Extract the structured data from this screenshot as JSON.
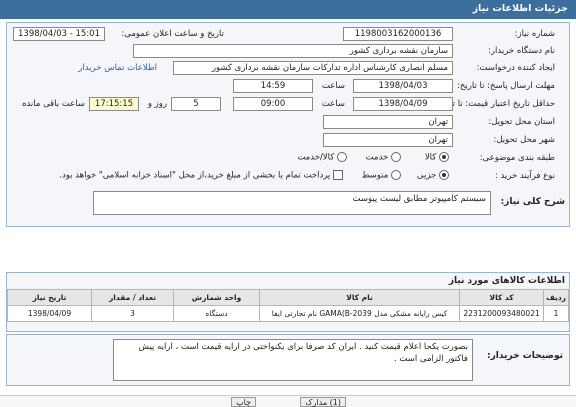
{
  "header": {
    "title": "جزئیات اطلاعات نیاز"
  },
  "form": {
    "need_number_label": "شماره نیاز:",
    "need_number": "1198003162000136",
    "announce_label": "تاریخ و ساعت اعلان عمومی:",
    "announce_value": "1398/04/03 - 15:01",
    "buyer_org_label": "نام دستگاه خریدار:",
    "buyer_org": "سازمان نقشه برداری کشور",
    "creator_label": "ایجاد کننده درخواست:",
    "creator": "مسلم انصاری کارشناس اداره تدارکات سازمان نقشه برداری کشور",
    "contact_link": "اطلاعات تماس خریدار",
    "deadline_label": "مهلت ارسال پاسخ: تا تاریخ:",
    "deadline_date": "1398/04/03",
    "time_label_1": "ساعت",
    "deadline_time": "14:59",
    "validity_label": "حداقل تاریخ اعتبار قیمت: تا تاریخ:",
    "validity_date": "1398/04/09",
    "time_label_2": "ساعت",
    "validity_time": "09:00",
    "days_value": "5",
    "days_label": "روز و",
    "remaining_time": "17:15:15",
    "remaining_label": "ساعت باقی مانده",
    "province_label": "استان محل تحویل:",
    "province": "تهران",
    "city_label": "شهر محل تحویل:",
    "city": "تهران",
    "category_label": "طبقه بندی موضوعی:",
    "category_options": [
      "کالا",
      "خدمت",
      "کالا/خدمت"
    ],
    "process_label": "نوع فرآیند خرید :",
    "process_options": [
      "جزیی",
      "متوسط"
    ],
    "payment_note": "پرداخت تمام یا بخشی از مبلغ خرید،از محل \"اسناد خزانه اسلامی\" خواهد بود."
  },
  "need_summary": {
    "label": "شرح کلی نیاز:",
    "value": "سیستم کامپیوتر مطابق لیست پیوست"
  },
  "goods": {
    "title": "اطلاعات کالاهای مورد نیاز",
    "columns": [
      "ردیف",
      "کد کالا",
      "نام کالا",
      "واحد شمارش",
      "تعداد / مقدار",
      "تاریخ نیاز"
    ],
    "rows": [
      [
        "1",
        "2231200093480021",
        "کیس رایانه مشکی مدل GAMA(B-2039 نام تجارتی ایفا",
        "دستگاه",
        "3",
        "1398/04/09"
      ]
    ]
  },
  "buyer_notes": {
    "label": "توضیحات خریدار:",
    "text": "بصورت یکجا اعلام قیمت کنید . ایران کد صرفا برای یکنواختی در ارایه قیمت است ، ارایه پیش فاکتور الزامی است ."
  },
  "footer": {
    "print_label": "چاپ",
    "attachments_label": "(1) مدارک"
  },
  "colors": {
    "header": "#3d6f9e",
    "panel_border": "#9ab4cf",
    "link": "#2a5db0",
    "remaining_bg": "#fffbd1"
  }
}
